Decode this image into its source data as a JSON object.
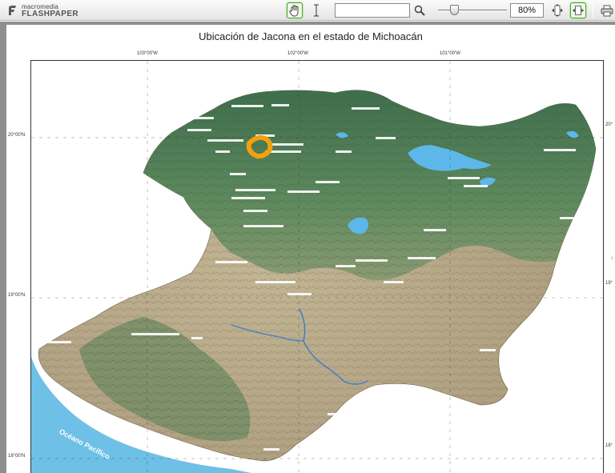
{
  "app": {
    "brand": "macromedia",
    "product": "FLASHPAPER"
  },
  "toolbar": {
    "hand_tool": "hand-icon",
    "text_tool": "text-cursor-icon",
    "search_value": "",
    "search_placeholder": "",
    "zoom_level_percent": 30,
    "zoom": "80%",
    "fit_width_tool": "fit-width-icon",
    "fit_page_tool": "fit-page-icon",
    "print_tool": "printer-icon"
  },
  "document": {
    "title": "Ubicación de Jacona en el estado de Michoacán",
    "ocean_label": "Océano Pacífico",
    "top_coords": [
      "103°00'W",
      "102°00'W",
      "101°00'W"
    ],
    "left_coords": [
      "20°00'N",
      "19°00'N",
      "18°00'N"
    ],
    "right_coords": [
      "20°",
      "19°",
      "18°"
    ]
  },
  "colors": {
    "highlight": "#f5a010",
    "ocean": "#6ec0e6",
    "lakes": "#5db7e8",
    "highlands": "#4f7a55",
    "lowlands": "#b6a98a"
  }
}
